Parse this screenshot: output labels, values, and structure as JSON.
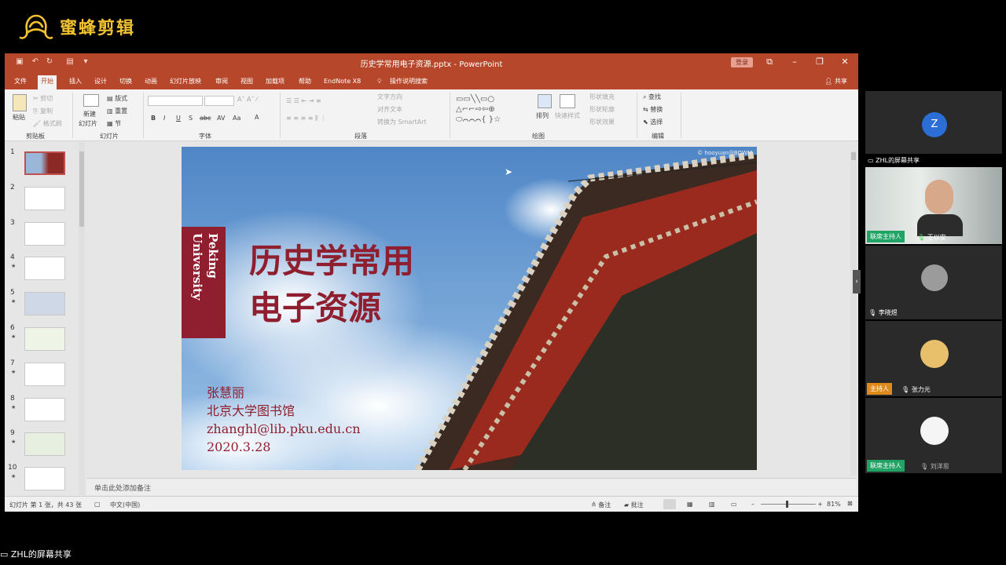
{
  "watermark": {
    "text": "蜜蜂剪辑",
    "icon": "bee-logo-icon",
    "color": "#f2c230"
  },
  "ppt": {
    "window_title": "历史学常用电子资源.pptx - PowerPoint",
    "login_label": "登录",
    "accent": "#b7472a",
    "tabs": [
      "文件",
      "开始",
      "插入",
      "设计",
      "切换",
      "动画",
      "幻灯片放映",
      "审阅",
      "视图",
      "加载项",
      "帮助",
      "EndNote X8"
    ],
    "active_tab": "开始",
    "tell_me": "操作说明搜索",
    "share": "共享",
    "ribbon": {
      "clipboard": {
        "label": "剪贴板",
        "paste": "粘贴",
        "cut": "剪切",
        "copy": "复制",
        "format_painter": "格式刷"
      },
      "slides": {
        "label": "幻灯片",
        "new_slide": "新建",
        "new_slide2": "幻灯片",
        "layout": "版式",
        "reset": "重置",
        "section": "节"
      },
      "font": {
        "label": "字体",
        "buttons": [
          "B",
          "I",
          "U",
          "S",
          "abc",
          "AV",
          "Aa",
          "A"
        ]
      },
      "paragraph": {
        "label": "段落",
        "text_direction": "文字方向",
        "align_text": "对齐文本",
        "convert_smartart": "转换为 SmartArt"
      },
      "drawing": {
        "label": "绘图",
        "arrange": "排列",
        "quick_styles": "快速样式",
        "shape_fill": "形状填充",
        "shape_outline": "形状轮廓",
        "shape_effects": "形状效果"
      },
      "editing": {
        "label": "编辑",
        "find": "查找",
        "replace": "替换",
        "select": "选择"
      }
    },
    "thumbnails": [
      "1",
      "2",
      "3",
      "4",
      "5",
      "6",
      "7",
      "8",
      "9",
      "10"
    ],
    "slide": {
      "vertical_brand": "Peking University",
      "title_line1": "历史学常用",
      "title_line2": "电子资源",
      "author_name": "张慧丽",
      "author_org": "北京大学图书馆",
      "author_email": "zhanghl@lib.pku.edu.cn",
      "date": "2020.3.28",
      "copyright": "© hooyuan@BOWM",
      "brand_color": "#8f1e2e"
    },
    "notes_placeholder": "单击此处添加备注",
    "status": {
      "slide_info": "幻灯片 第 1 张，共 43 张",
      "language": "中文(中国)",
      "notes": "备注",
      "comments": "批注",
      "zoom": "81%"
    }
  },
  "participants": {
    "host_share": "ZHL的屏幕共享",
    "p1_initial": "Z",
    "p2_name": "王以安",
    "p2_badge": "联席主持人",
    "p3_name": "李晓煜",
    "p4_name": "张力元",
    "p4_badge": "主持人",
    "p5_name": "刘洋思",
    "p5_badge": "联席主持人"
  },
  "bottom_label": "ZHL的屏幕共享"
}
